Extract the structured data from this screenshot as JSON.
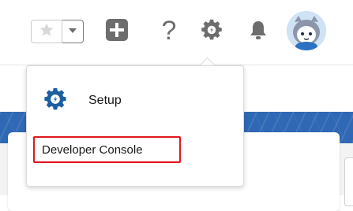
{
  "header": {
    "icons": {
      "favorite": "star-icon",
      "favorites_list": "chevron-down-icon",
      "global_actions": "plus-icon",
      "help": "question-mark-icon",
      "setup": "gear-icon",
      "notifications": "bell-icon",
      "avatar": "astro-avatar"
    },
    "help_glyph": "?"
  },
  "menu": {
    "items": [
      {
        "label": "Setup",
        "icon": "gear-icon"
      },
      {
        "label": "Developer Console",
        "highlighted": true
      }
    ]
  },
  "colors": {
    "icon_gray": "#6d6d6d",
    "setup_icon": "#1b5fa3",
    "highlight_border": "#e0161b",
    "banner_blue": "#2f68b4"
  }
}
